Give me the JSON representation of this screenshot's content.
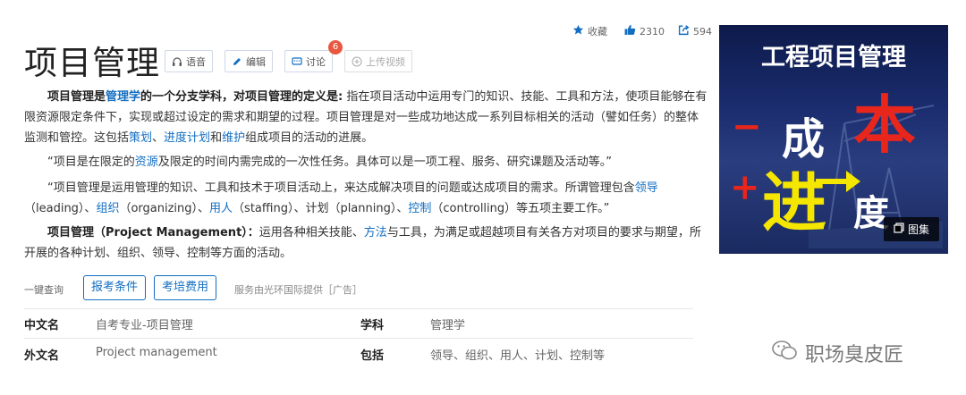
{
  "header": {
    "title": "项目管理",
    "buttons": {
      "voice": "语音",
      "edit": "编辑",
      "discuss": "讨论",
      "discuss_count": "6",
      "upload": "上传视频"
    }
  },
  "stats": {
    "favorite": "收藏",
    "likes": "2310",
    "shares": "594"
  },
  "paragraphs": {
    "p1": {
      "b1": "项目管理是",
      "l1": "管理学",
      "b2": "的一个分支学科，对项目管理的定义是:",
      "t1": " 指在项目活动中运用专门的知识、技能、工具和方法，使项目能够在有限资源限定条件下，实现或超过设定的需求和期望的过程。项目管理是对一些成功地达成一系列目标相关的活动（譬如任务）的整体监测和管控。这包括",
      "l2": "策划",
      "t2": "、",
      "l3": "进度计划",
      "t3": "和",
      "l4": "维护",
      "t4": "组成项目的活动的进展。"
    },
    "p2": {
      "t1": "“项目是在限定的",
      "l1": "资源",
      "t2": "及限定的时间内需完成的一次性任务。具体可以是一项工程、服务、研究课题及活动等。”"
    },
    "p3": {
      "t1": "“项目管理是运用管理的知识、工具和技术于项目活动上，来达成解决项目的问题或达成项目的需求。所谓管理包含",
      "l1": "领导",
      "t2": "（leading）、",
      "l2": "组织",
      "t3": "（organizing）、",
      "l3": "用人",
      "t4": "（staffing）、计划（planning）、",
      "l4": "控制",
      "t5": "（controlling）等五项主要工作。”"
    },
    "p4": {
      "b1": "项目管理（Project Management）：",
      "t1": "运用各种相关技能、",
      "l1": "方法",
      "t2": "与工具，为满足或超越项目有关各方对项目的要求与期望，所开展的各种计划、组织、领导、控制等方面的活动。"
    }
  },
  "quick": {
    "label": "一键查询",
    "btn1": "报考条件",
    "btn2": "考培费用",
    "service": "服务由光环国际提供［广告］"
  },
  "info": {
    "k1": "中文名",
    "v1": "自考专业-项目管理",
    "k2": "学科",
    "v2": "管理学",
    "k3": "外文名",
    "v3": "Project management",
    "k4": "包括",
    "v4": "领导、组织、用人、计划、控制等"
  },
  "image": {
    "title": "工程项目管理",
    "minus": "−",
    "cheng": "成",
    "ben": "本",
    "plus": "+",
    "jin": "进",
    "du": "度",
    "gallery": "图集"
  },
  "watermark": "职场臭皮匠",
  "colors": {
    "link": "#136ec2",
    "badge": "#e9573f",
    "red": "#e8261c",
    "yellow": "#f5e600"
  }
}
